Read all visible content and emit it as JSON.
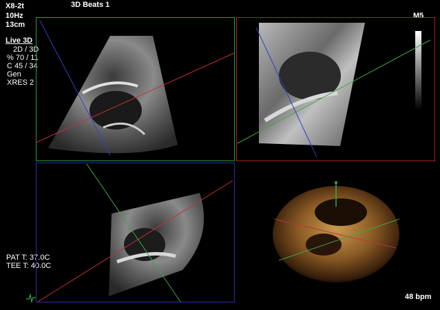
{
  "header": {
    "probe": "X8-2t",
    "frame_rate": "10Hz",
    "depth": "13cm",
    "title": "3D Beats 1"
  },
  "mode_panel": {
    "mode": "Live 3D",
    "lines": [
      "2D / 3D",
      "% 70 / 11",
      "C 45 / 34",
      "Gen",
      "XRES 2"
    ]
  },
  "grayscale_map": {
    "label": "M5"
  },
  "temperatures": {
    "pat": "PAT T: 37.0C",
    "tee": "TEE T: 40.0C"
  },
  "heart_rate": "48 bpm",
  "colors": {
    "top_left_frame": "#2f9e3a",
    "top_right_frame": "#b0202a",
    "bottom_left_frame": "#2b2fa8",
    "red_plane": "#c0303a",
    "green_plane": "#3aa84a",
    "blue_plane": "#3040c0"
  }
}
